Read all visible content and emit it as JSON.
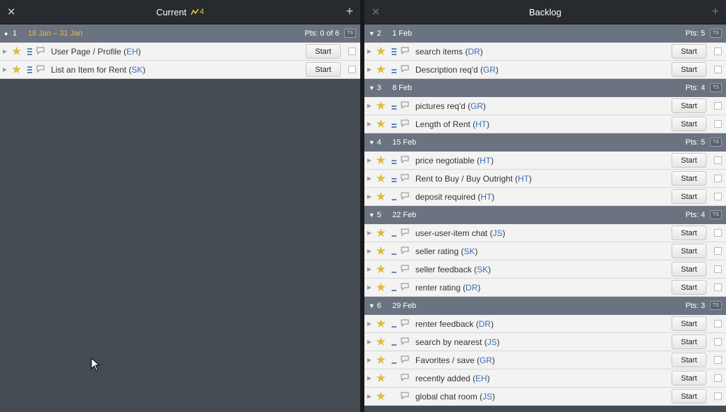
{
  "current": {
    "title": "Current",
    "velocity": "4",
    "iteration": {
      "toggle": "●",
      "num": "1",
      "dates": "18 Jan – 31 Jan",
      "pts": "Pts: 0 of 6",
      "ts": "TS"
    },
    "stories": [
      {
        "title": "User Page / Profile",
        "owner": "EH",
        "est": 3
      },
      {
        "title": "List an Item for Rent",
        "owner": "SK",
        "est": 3
      }
    ]
  },
  "backlog": {
    "title": "Backlog",
    "iterations": [
      {
        "toggle": "▼",
        "num": "2",
        "dates": "1 Feb",
        "pts": "Pts: 5",
        "ts": "TS",
        "stories": [
          {
            "title": "search items",
            "owner": "DR",
            "est": 3
          },
          {
            "title": "Description req'd",
            "owner": "GR",
            "est": 2
          }
        ]
      },
      {
        "toggle": "▼",
        "num": "3",
        "dates": "8 Feb",
        "pts": "Pts: 4",
        "ts": "TS",
        "stories": [
          {
            "title": "pictures req'd",
            "owner": "GR",
            "est": 2
          },
          {
            "title": "Length of Rent",
            "owner": "HT",
            "est": 2
          }
        ]
      },
      {
        "toggle": "▼",
        "num": "4",
        "dates": "15 Feb",
        "pts": "Pts: 5",
        "ts": "TS",
        "stories": [
          {
            "title": "price negotiable",
            "owner": "HT",
            "est": 2
          },
          {
            "title": "Rent to Buy / Buy Outright",
            "owner": "HT",
            "est": 2
          },
          {
            "title": "deposit required",
            "owner": "HT",
            "est": 1
          }
        ]
      },
      {
        "toggle": "▼",
        "num": "5",
        "dates": "22 Feb",
        "pts": "Pts: 4",
        "ts": "TS",
        "stories": [
          {
            "title": "user-user-item chat",
            "owner": "JS",
            "est": 1
          },
          {
            "title": "seller rating ",
            "owner": "SK",
            "est": 1
          },
          {
            "title": "seller feedback",
            "owner": "SK",
            "est": 1
          },
          {
            "title": "renter rating",
            "owner": "DR",
            "est": 1
          }
        ]
      },
      {
        "toggle": "▼",
        "num": "6",
        "dates": "29 Feb",
        "pts": "Pts: 3",
        "ts": "TS",
        "stories": [
          {
            "title": "renter feedback",
            "owner": "DR",
            "est": 1
          },
          {
            "title": "search by nearest",
            "owner": "JS",
            "est": 1
          },
          {
            "title": "Favorites / save ",
            "owner": "GR",
            "est": 1
          },
          {
            "title": "recently added",
            "owner": "EH",
            "est": 0
          },
          {
            "title": "global chat room",
            "owner": "JS",
            "est": 0
          }
        ]
      }
    ]
  },
  "labels": {
    "start": "Start",
    "close": "✕",
    "add": "+"
  },
  "colors": {
    "star": "#e2b93b",
    "owner": "#3b6db1",
    "iteration_bar": "#6b7381",
    "current_dates": "#f3b43c"
  }
}
